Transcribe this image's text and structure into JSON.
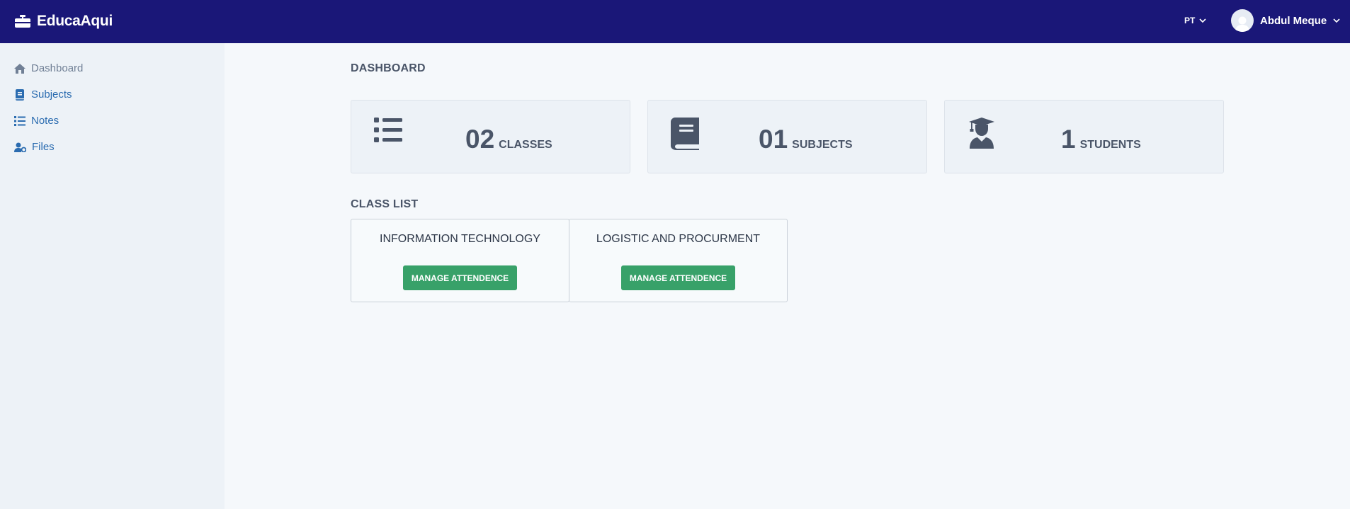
{
  "app": {
    "name": "EducaAqui"
  },
  "header": {
    "language": "PT",
    "user_name": "Abdul Meque"
  },
  "sidebar": {
    "items": [
      {
        "label": "Dashboard",
        "icon": "home-icon"
      },
      {
        "label": "Subjects",
        "icon": "book-icon"
      },
      {
        "label": "Notes",
        "icon": "list-icon"
      },
      {
        "label": "Files",
        "icon": "user-cog-icon"
      }
    ]
  },
  "main": {
    "title": "DASHBOARD",
    "stats": [
      {
        "value": "02",
        "label": "CLASSES",
        "icon": "list-icon"
      },
      {
        "value": "01",
        "label": "SUBJECTS",
        "icon": "book-icon"
      },
      {
        "value": "1",
        "label": "STUDENTS",
        "icon": "graduate-icon"
      }
    ],
    "class_list_title": "CLASS LIST",
    "classes": [
      {
        "name": "INFORMATION TECHNOLOGY",
        "button": "MANAGE ATTENDENCE"
      },
      {
        "name": "LOGISTIC AND PROCURMENT",
        "button": "MANAGE ATTENDENCE"
      }
    ]
  },
  "colors": {
    "topbar": "#1a1778",
    "sidebar": "#edf2f7",
    "accent_button": "#38a169",
    "link": "#2b6cb0"
  }
}
